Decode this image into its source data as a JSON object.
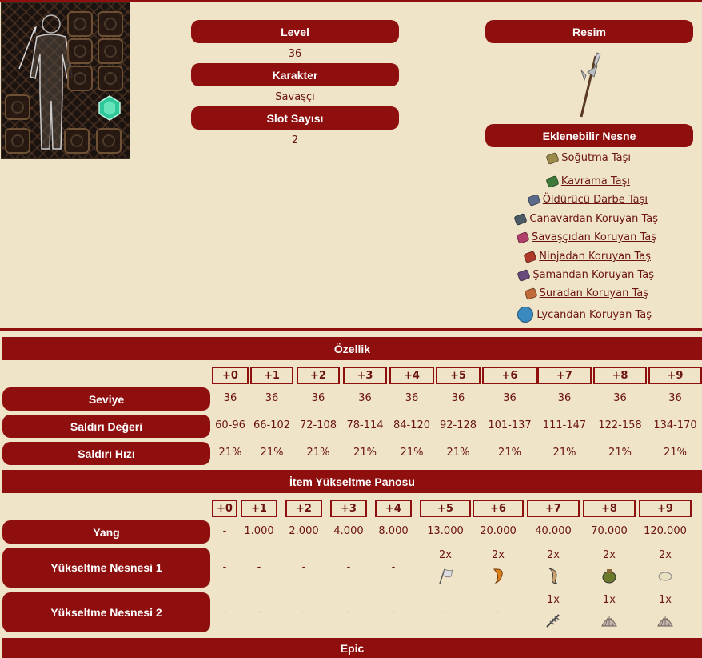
{
  "top": {
    "level_label": "Level",
    "level_value": "36",
    "character_label": "Karakter",
    "character_value": "Savaşçı",
    "slot_label": "Slot Sayısı",
    "slot_value": "2",
    "image_label": "Resim",
    "addable_label": "Eklenebilir Nesne"
  },
  "stones": [
    {
      "label": "Soğutma Taşı",
      "icon": "cooling-stone-icon",
      "color": "#9c8a4a"
    },
    {
      "label": "Kavrama Taşı",
      "icon": "grip-stone-icon",
      "color": "#3e7a3a"
    },
    {
      "label": "Öldürücü Darbe Taşı",
      "icon": "critical-stone-icon",
      "color": "#5a6a8a"
    },
    {
      "label": "Canavardan Koruyan Taş",
      "icon": "monster-stone-icon",
      "color": "#4c5a66"
    },
    {
      "label": "Savaşçıdan Koruyan Taş",
      "icon": "warrior-stone-icon",
      "color": "#b0406a"
    },
    {
      "label": "Ninjadan Koruyan Taş",
      "icon": "ninja-stone-icon",
      "color": "#b03a2a"
    },
    {
      "label": "Şamandan Koruyan Taş",
      "icon": "shaman-stone-icon",
      "color": "#6a4a7a"
    },
    {
      "label": "Suradan Koruyan Taş",
      "icon": "sura-stone-icon",
      "color": "#c06a3a"
    },
    {
      "label": "Lycandan Koruyan Taş",
      "icon": "lycan-stone-icon",
      "color": "#3a8ac0"
    }
  ],
  "ozellik": {
    "title": "Özellik",
    "levels": [
      "+0",
      "+1",
      "+2",
      "+3",
      "+4",
      "+5",
      "+6",
      "+7",
      "+8",
      "+9"
    ],
    "rows": [
      {
        "label": "Seviye",
        "values": [
          "36",
          "36",
          "36",
          "36",
          "36",
          "36",
          "36",
          "36",
          "36",
          "36"
        ]
      },
      {
        "label": "Saldırı Değeri",
        "values": [
          "60-96",
          "66-102",
          "72-108",
          "78-114",
          "84-120",
          "92-128",
          "101-137",
          "111-147",
          "122-158",
          "134-170"
        ]
      },
      {
        "label": "Saldırı Hızı",
        "values": [
          "21%",
          "21%",
          "21%",
          "21%",
          "21%",
          "21%",
          "21%",
          "21%",
          "21%",
          "21%"
        ]
      }
    ]
  },
  "upgrade": {
    "title": "İtem Yükseltme Panosu",
    "levels": [
      "+0",
      "+1",
      "+2",
      "+3",
      "+4",
      "+5",
      "+6",
      "+7",
      "+8",
      "+9"
    ],
    "yang_label": "Yang",
    "yang": [
      "-",
      "1.000",
      "2.000",
      "4.000",
      "8.000",
      "13.000",
      "20.000",
      "40.000",
      "70.000",
      "120.000"
    ],
    "mat1_label": "Yükseltme Nesnesi 1",
    "mat1": [
      "-",
      "-",
      "-",
      "-",
      "-",
      "2x",
      "2x",
      "2x",
      "2x",
      "2x"
    ],
    "mat1_icons": [
      "",
      "",
      "",
      "",
      "",
      "flag-icon",
      "dragon-scale-icon",
      "claw-icon",
      "pouch-icon",
      "egg-icon"
    ],
    "mat2_label": "Yükseltme Nesnesi 2",
    "mat2": [
      "-",
      "-",
      "-",
      "-",
      "-",
      "-",
      "-",
      "1x",
      "1x",
      "1x"
    ],
    "mat2_icons": [
      "",
      "",
      "",
      "",
      "",
      "",
      "",
      "fish-bone-icon",
      "shell-icon",
      "shell-icon"
    ]
  },
  "epic": {
    "title": "Epic"
  }
}
